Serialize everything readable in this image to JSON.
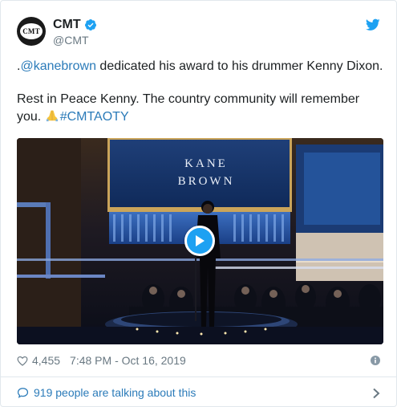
{
  "tweet": {
    "display_name": "CMT",
    "handle": "@CMT",
    "avatar_text": "CMT",
    "line1_prefix": ".",
    "mention": "@kanebrown",
    "line1_rest": " dedicated his award to his drummer Kenny Dixon.",
    "line2_text": "Rest in Peace Kenny. The country community will remember you. ",
    "hashtag": "#CMTAOTY",
    "emoji": "folded-hands-emoji",
    "verified_icon": "verified-badge-icon",
    "brand_icon": "twitter-bird-icon"
  },
  "media": {
    "screen_line1": "KANE",
    "screen_line2": "BROWN",
    "play_icon": "play-icon"
  },
  "meta": {
    "likes": "4,455",
    "timestamp": "7:48 PM - Oct 16, 2019",
    "heart_icon": "heart-icon",
    "info_icon": "info-icon"
  },
  "footer": {
    "conversation": "919 people are talking about this",
    "comment_icon": "comment-icon",
    "chevron_icon": "chevron-right-icon"
  },
  "colors": {
    "link": "#2b7bb9",
    "secondary_text": "#697882",
    "twitter_blue": "#1da1f2",
    "border": "#e1e8ed"
  }
}
